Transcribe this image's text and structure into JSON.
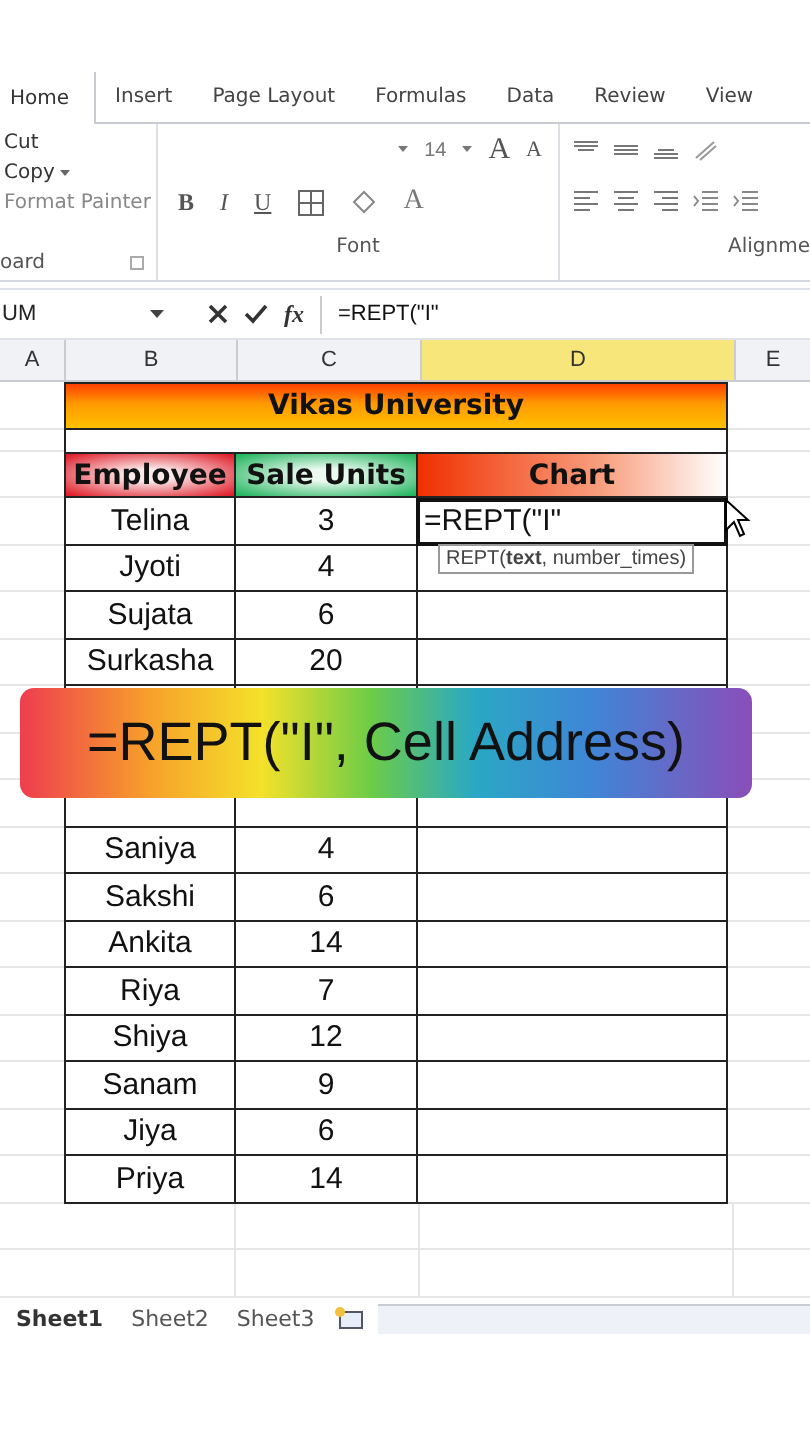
{
  "ribbon": {
    "tabs": [
      {
        "label": "Home",
        "selected": true
      },
      {
        "label": "Insert",
        "selected": false
      },
      {
        "label": "Page Layout",
        "selected": false
      },
      {
        "label": "Formulas",
        "selected": false
      },
      {
        "label": "Data",
        "selected": false
      },
      {
        "label": "Review",
        "selected": false
      },
      {
        "label": "View",
        "selected": false
      }
    ],
    "clipboard": {
      "cut": "Cut",
      "copy": "Copy",
      "format_painter": "Format Painter",
      "group_label": "oard"
    },
    "font": {
      "size": "14",
      "grow": "A",
      "shrink": "A",
      "bold": "B",
      "italic": "I",
      "underline": "U",
      "font_color": "A",
      "group_label": "Font"
    },
    "alignment": {
      "group_label": "Alignme"
    }
  },
  "formula_bar": {
    "name_box": "UM",
    "fx": "fx",
    "formula": "=REPT(\"I\""
  },
  "columns": [
    {
      "label": "A",
      "selected": false
    },
    {
      "label": "B",
      "selected": false
    },
    {
      "label": "C",
      "selected": false
    },
    {
      "label": "D",
      "selected": true
    },
    {
      "label": "E",
      "selected": false
    }
  ],
  "sheet": {
    "title": "Vikas University",
    "headers": [
      "Employee",
      "Sale Units",
      "Chart"
    ],
    "rows": [
      {
        "kind": "data",
        "employee": "Telina",
        "units": "3",
        "chart": "=REPT(\"I\"",
        "tooltip": "REPT(**text**, number_times)"
      },
      {
        "kind": "data",
        "employee": "Jyoti",
        "units": "4"
      },
      {
        "kind": "data",
        "employee": "Sujata",
        "units": "6"
      },
      {
        "kind": "data",
        "employee": "Surkasha",
        "units": "20"
      },
      {
        "kind": "covered"
      },
      {
        "kind": "hidden"
      },
      {
        "kind": "covered"
      },
      {
        "kind": "data",
        "employee": "Saniya",
        "units": "4"
      },
      {
        "kind": "data",
        "employee": "Sakshi",
        "units": "6"
      },
      {
        "kind": "data",
        "employee": "Ankita",
        "units": "14"
      },
      {
        "kind": "data",
        "employee": "Riya",
        "units": "7"
      },
      {
        "kind": "data",
        "employee": "Shiya",
        "units": "12"
      },
      {
        "kind": "data",
        "employee": "Sanam",
        "units": "9"
      },
      {
        "kind": "data",
        "employee": "Jiya",
        "units": "6"
      },
      {
        "kind": "data",
        "employee": "Priya",
        "units": "14"
      }
    ]
  },
  "banner": "=REPT(\"I\", Cell Address)",
  "sheet_tabs": [
    {
      "label": "Sheet1",
      "selected": true
    },
    {
      "label": "Sheet2",
      "selected": false
    },
    {
      "label": "Sheet3",
      "selected": false
    }
  ]
}
